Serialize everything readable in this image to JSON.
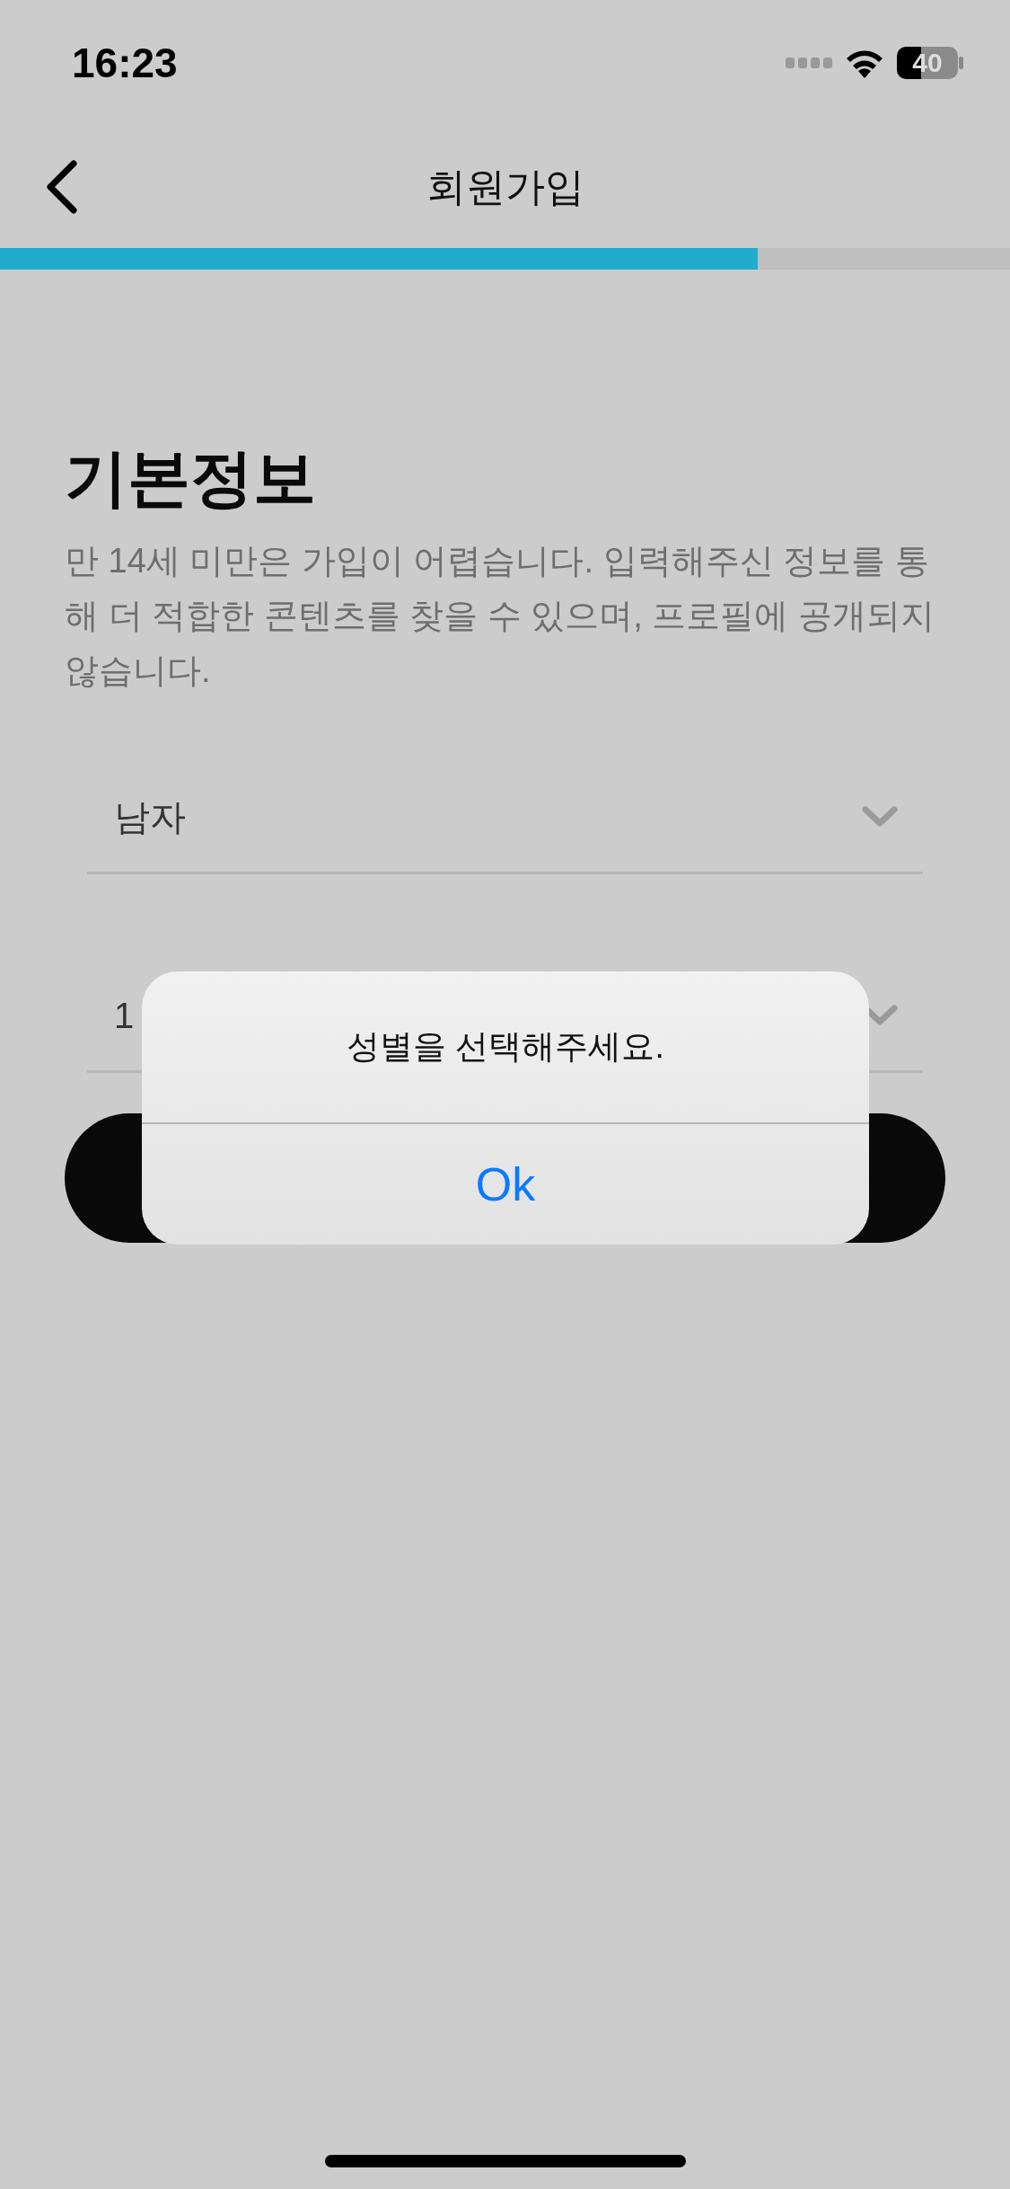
{
  "status_bar": {
    "time": "16:23",
    "battery": "40"
  },
  "nav": {
    "title": "회원가입"
  },
  "progress": {
    "level": 0.75
  },
  "heading": "기본정보",
  "description": "만 14세 미만은 가입이 어렵습니다. 입력해주신 정보를 통해 더 적합한 콘텐츠를 찾을 수 있으며, 프로필에 공개되지 않습니다.",
  "fields": [
    {
      "value": "남자"
    },
    {
      "value": "1"
    }
  ],
  "alert": {
    "message": "성별을 선택해주세요.",
    "buttons": [
      "Ok"
    ]
  }
}
